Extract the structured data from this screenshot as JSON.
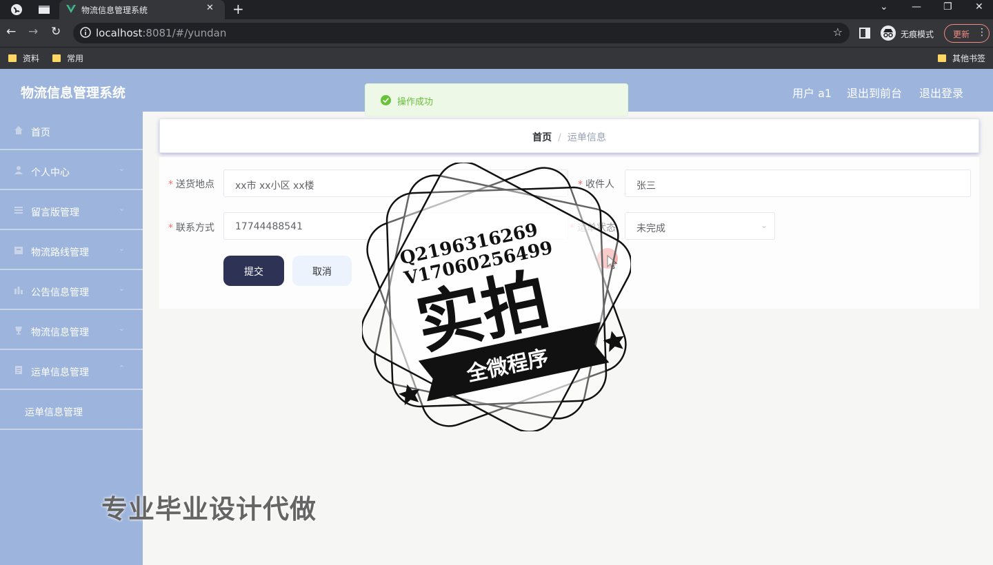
{
  "browser": {
    "tab_title": "物流信息管理系统",
    "url_host": "localhost",
    "url_rest": ":8081/#/yundan",
    "incognito_label": "无痕模式",
    "update_label": "更新",
    "bookmarks": [
      "资料",
      "常用"
    ],
    "other_bookmarks": "其他书签"
  },
  "header": {
    "title": "物流信息管理系统",
    "user": "用户 a1",
    "to_front": "退出到前台",
    "logout": "退出登录"
  },
  "sidebar": {
    "items": [
      {
        "label": "首页",
        "icon": "home-icon"
      },
      {
        "label": "个人中心",
        "icon": "user-icon"
      },
      {
        "label": "留言版管理",
        "icon": "list-icon"
      },
      {
        "label": "物流路线管理",
        "icon": "box-icon"
      },
      {
        "label": "公告信息管理",
        "icon": "chart-icon"
      },
      {
        "label": "物流信息管理",
        "icon": "cup-icon"
      },
      {
        "label": "运单信息管理",
        "icon": "document-icon"
      }
    ],
    "sub_item": "运单信息管理"
  },
  "breadcrumb": {
    "home": "首页",
    "separator": "/",
    "current": "运单信息"
  },
  "toast": {
    "message": "操作成功",
    "type": "success"
  },
  "form": {
    "address_label": "送货地点",
    "address_value": "xx市 xx小区 xx楼",
    "receiver_label": "收件人",
    "receiver_value": "张三",
    "phone_label": "联系方式",
    "phone_value": "17744488541",
    "status_label": "运单状态",
    "status_value": "未完成",
    "submit": "提交",
    "cancel": "取消"
  },
  "overlay": {
    "stamp_line1": "Q2196316269",
    "stamp_line2": "V17060256499",
    "stamp_big": "实拍",
    "stamp_ribbon": "全微程序",
    "watermark": "专业毕业设计代做"
  },
  "colors": {
    "header_bg": "#9db4dc",
    "submit_bg": "#2e3356",
    "required": "#f56c6c",
    "success": "#67c23a"
  }
}
